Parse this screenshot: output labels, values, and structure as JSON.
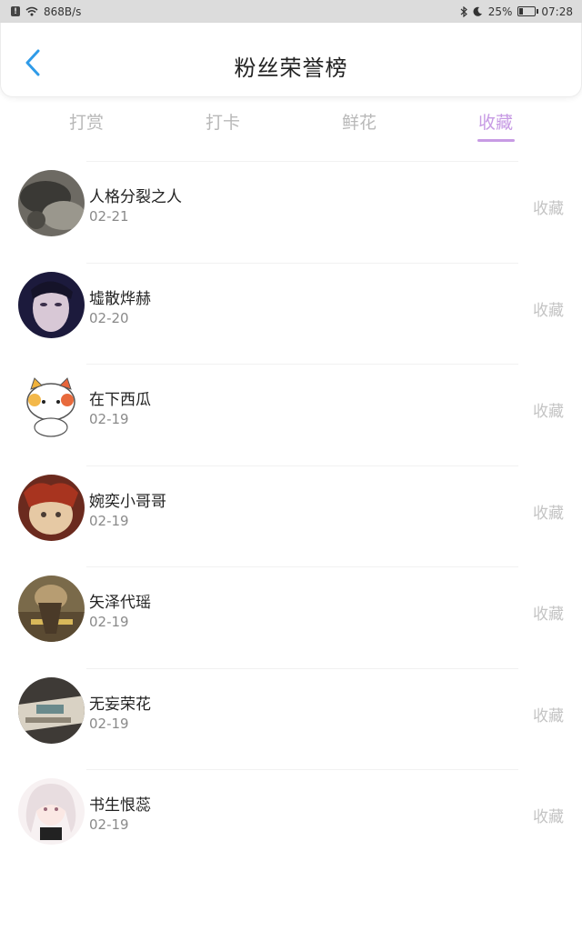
{
  "status_bar": {
    "net_speed": "868B/s",
    "battery": "25%",
    "battery_level": 0.25,
    "time": "07:28"
  },
  "header": {
    "title": "粉丝荣誉榜"
  },
  "tabs": [
    {
      "label": "打赏",
      "active": false
    },
    {
      "label": "打卡",
      "active": false
    },
    {
      "label": "鲜花",
      "active": false
    },
    {
      "label": "收藏",
      "active": true
    }
  ],
  "colors": {
    "accent": "#c79be4",
    "back_icon": "#2f9be8",
    "tab_inactive": "#b8b8b8",
    "action_text": "#c4c4c4"
  },
  "fans": [
    {
      "name": "人格分裂之人",
      "date": "02-21",
      "action": "收藏"
    },
    {
      "name": "墟散烨赫",
      "date": "02-20",
      "action": "收藏"
    },
    {
      "name": "在下西瓜",
      "date": "02-19",
      "action": "收藏"
    },
    {
      "name": "婉奕小哥哥",
      "date": "02-19",
      "action": "收藏"
    },
    {
      "name": "矢泽代瑶",
      "date": "02-19",
      "action": "收藏"
    },
    {
      "name": "无妄荣花",
      "date": "02-19",
      "action": "收藏"
    },
    {
      "name": "书生恨蕊",
      "date": "02-19",
      "action": "收藏"
    }
  ]
}
